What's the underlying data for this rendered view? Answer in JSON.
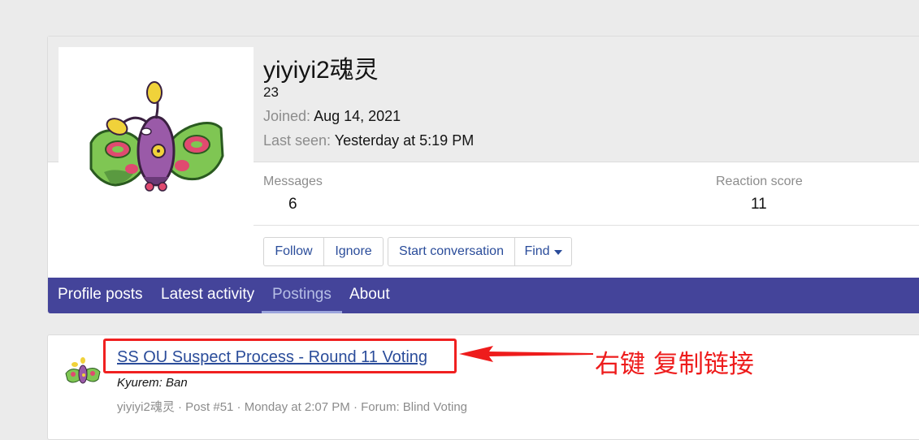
{
  "profile": {
    "username": "yiyiyi2魂灵",
    "user_title": "23",
    "joined_label": "Joined:",
    "joined_value": "Aug 14, 2021",
    "last_seen_label": "Last seen:",
    "last_seen_value": "Yesterday at 5:19 PM",
    "avatar_icon": "pokemon-sprite-icon"
  },
  "stats": [
    {
      "label": "Messages",
      "value": "6"
    },
    {
      "label": "Reaction score",
      "value": "11"
    }
  ],
  "actions": {
    "follow": "Follow",
    "ignore": "Ignore",
    "start_conversation": "Start conversation",
    "find": "Find"
  },
  "tabs": [
    {
      "label": "Profile posts",
      "active": false
    },
    {
      "label": "Latest activity",
      "active": false
    },
    {
      "label": "Postings",
      "active": true
    },
    {
      "label": "About",
      "active": false
    }
  ],
  "post": {
    "title": "SS OU Suspect Process - Round 11 Voting",
    "snippet": "Kyurem: Ban",
    "meta": "yiyiyi2魂灵 · Post #51 · Monday at 2:07 PM · Forum: Blind Voting"
  },
  "annotation": {
    "text": "右键 复制链接",
    "color": "#ee1c1c"
  },
  "colors": {
    "accent": "#44449a",
    "link": "#2a4c9a",
    "muted": "#8c8c8c"
  }
}
